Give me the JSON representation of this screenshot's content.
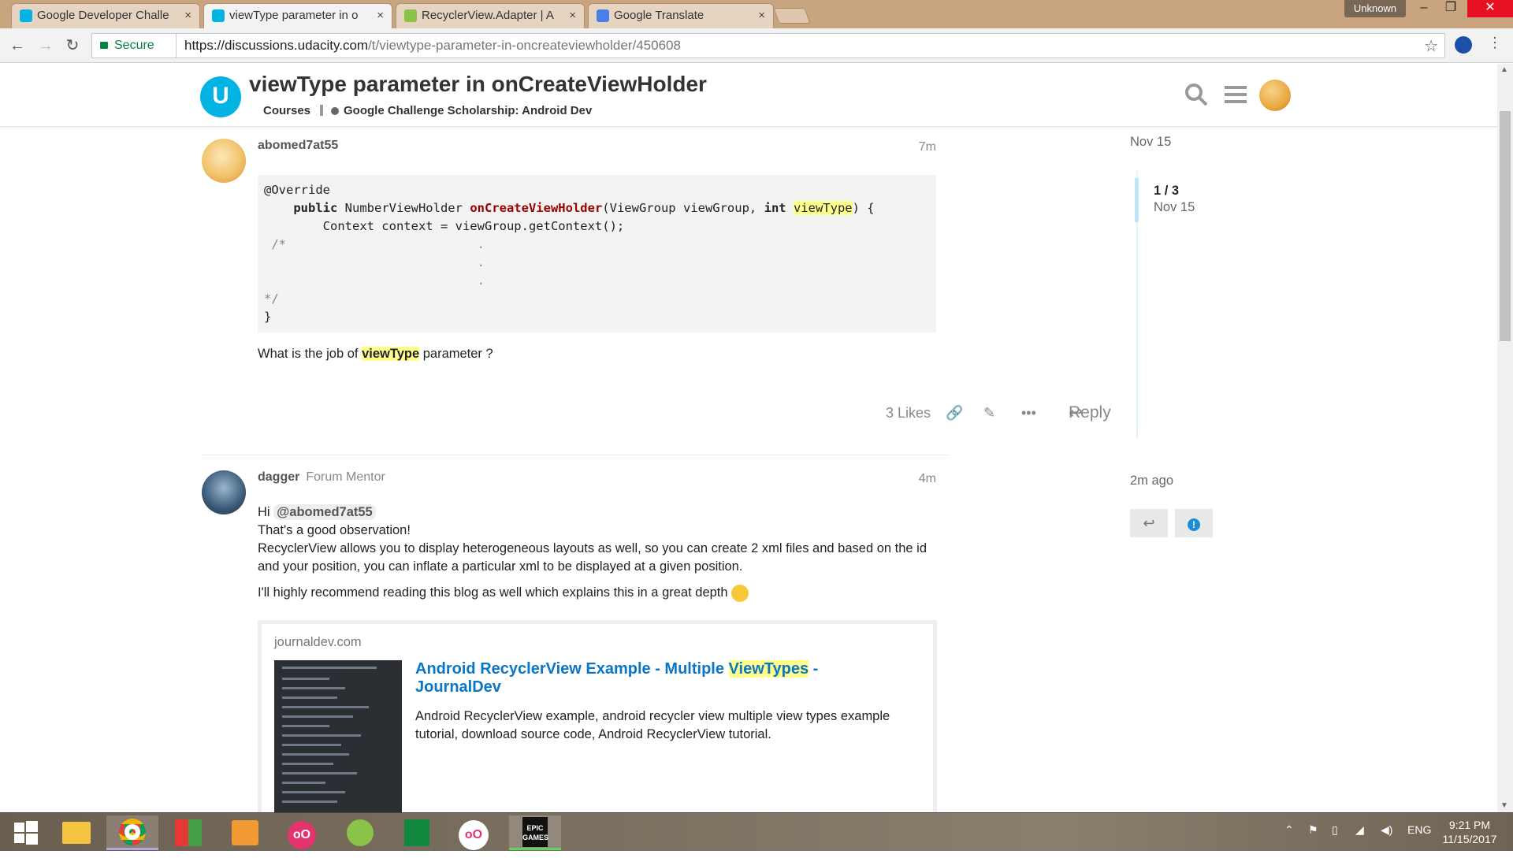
{
  "browser": {
    "tabs": [
      {
        "label": "Google Developer Challe",
        "icon": "udacity-icon",
        "active": false
      },
      {
        "label": "viewType parameter in o",
        "icon": "udacity-icon",
        "active": true
      },
      {
        "label": "RecyclerView.Adapter | A",
        "icon": "android-icon",
        "active": false
      },
      {
        "label": "Google Translate",
        "icon": "translate-icon",
        "active": false
      }
    ],
    "profile_label": "Unknown",
    "secure_label": "Secure",
    "url_host": "https://discussions.udacity.com",
    "url_path": "/t/viewtype-parameter-in-oncreateviewholder/450608"
  },
  "topic": {
    "title": "viewType parameter in onCreateViewHolder",
    "category": "Courses",
    "subcategory": "Google Challenge Scholarship: Android Dev"
  },
  "posts": [
    {
      "username": "abomed7at55",
      "time": "7m",
      "code": {
        "l1": "@Override",
        "l2_kw": "public",
        "l2_type": " NumberViewHolder ",
        "l2_fn": "onCreateViewHolder",
        "l2_args": "(ViewGroup viewGroup, ",
        "l2_int": "int",
        "l2_hl": "viewType",
        "l2_end": ") {",
        "l3": "        Context context = viewGroup.getContext();",
        "l4": " /*                          .",
        "l5": "                             .",
        "l6": "                             .",
        "l7": "*/",
        "l8": "}"
      },
      "question_pre": "What is the job of ",
      "question_hl": "viewType",
      "question_post": " parameter ?",
      "likes": "3 Likes",
      "reply": "Reply"
    },
    {
      "username": "dagger",
      "role": "Forum Mentor",
      "time": "4m",
      "greeting": "Hi ",
      "mention": "@abomed7at55",
      "line2": "That's a good observation!",
      "line3": "RecyclerView allows you to display heterogeneous layouts as well, so you can create 2 xml files and based on the id and your position, you can inflate a particular xml to be displayed at a given position.",
      "line4": "I'll highly recommend reading this blog as well which explains this in a great depth",
      "onebox": {
        "site": "journaldev.com",
        "title_pre": "Android RecyclerView Example - Multiple ",
        "title_hl": "ViewTypes",
        "title_post": " - JournalDev",
        "description": "Android RecyclerView example, android recycler view multiple view types example tutorial, download source code, Android RecyclerView tutorial."
      }
    }
  ],
  "timeline": {
    "start": "Nov 15",
    "position": "1 / 3",
    "position_date": "Nov 15",
    "end": "2m ago"
  },
  "taskbar": {
    "language": "ENG",
    "time": "9:21 PM",
    "date": "11/15/2017"
  },
  "colors": {
    "udacity": "#02b3e4",
    "link": "#0a76c4",
    "highlight": "#ffff8e"
  }
}
